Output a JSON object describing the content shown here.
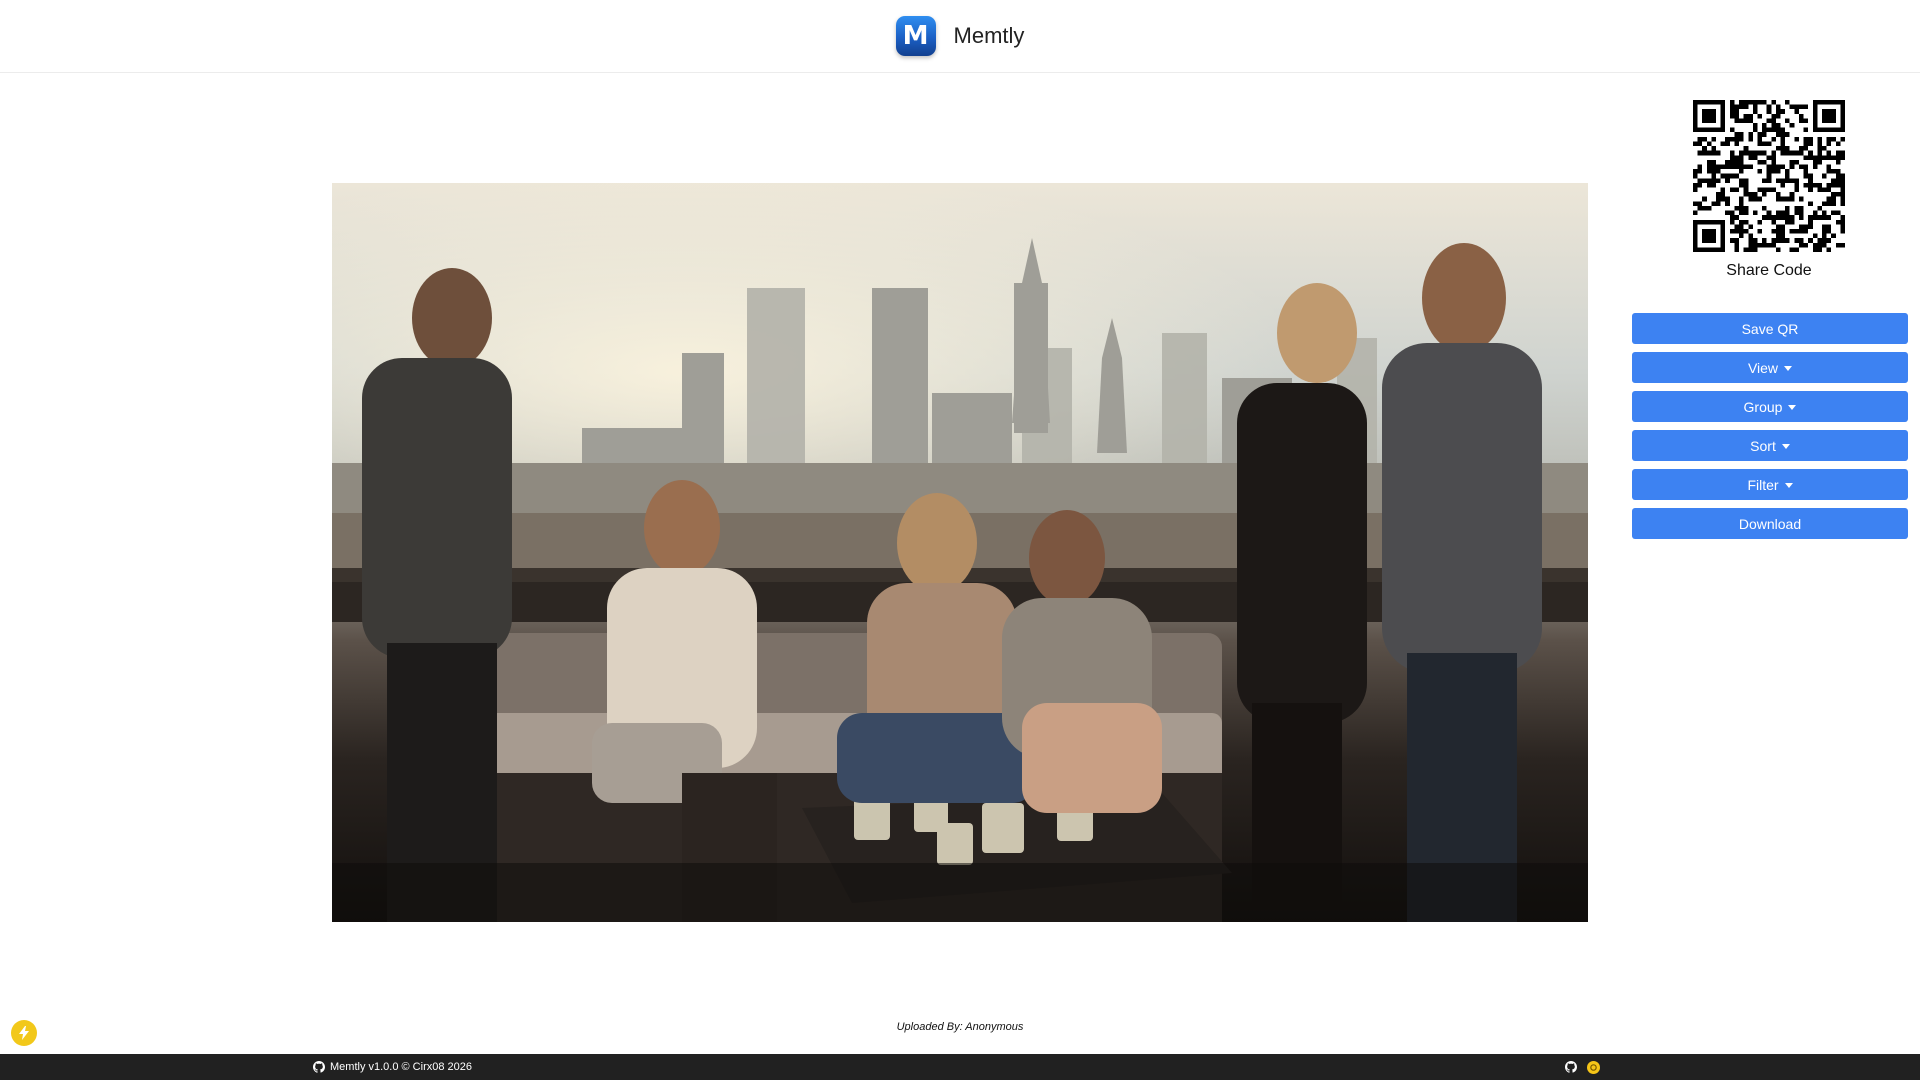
{
  "header": {
    "logo_letter": "M",
    "app_name": "Memtly"
  },
  "photo": {
    "icon": "group-photo-image"
  },
  "sidebar": {
    "qr_icon": "qr-code-icon",
    "share_label": "Share Code",
    "buttons": {
      "save_qr": "Save QR",
      "view": "View",
      "group": "Group",
      "sort": "Sort",
      "filter": "Filter",
      "download": "Download"
    },
    "accent_color": "#3d82f2"
  },
  "uploader": {
    "text": "Uploaded By: Anonymous"
  },
  "footer": {
    "credit": "Memtly v1.0.0 © Cirx08 2026",
    "icons": [
      "github-icon",
      "coin-icon"
    ]
  },
  "floating": {
    "icon": "lightning-bolt-icon",
    "color": "#f2c81a"
  }
}
